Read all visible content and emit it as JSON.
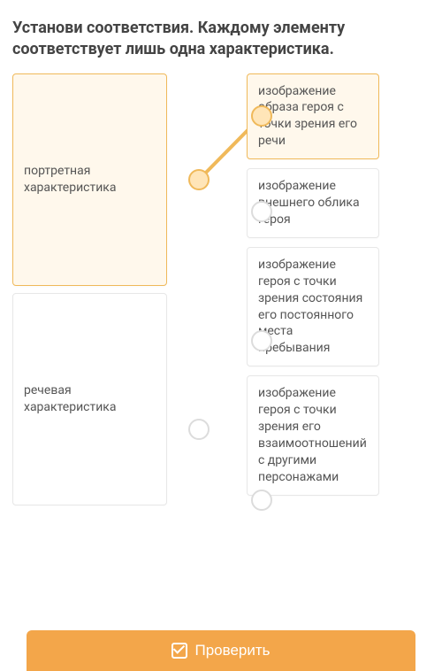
{
  "prompt": "Установи соответствия. Каждому элементу соответствует лишь одна характеристика.",
  "left_items": [
    {
      "label": "портретная характеристика",
      "selected": true
    },
    {
      "label": "речевая характеристика",
      "selected": false
    }
  ],
  "right_items": [
    {
      "label": "изображение образа героя с точки зрения его речи",
      "selected": true
    },
    {
      "label": "изображение внешнего облика героя",
      "selected": false
    },
    {
      "label": "изображение героя с точки зрения состояния его постоянного места пребывания",
      "selected": false
    },
    {
      "label": "изображение героя с точки зрения его взаимоотношений с другими персонажами",
      "selected": false
    }
  ],
  "connection": {
    "from_left": 0,
    "to_right": 0
  },
  "check_button_label": "Проверить",
  "colors": {
    "accent": "#f3a64a",
    "highlight_bg": "#fff8ec",
    "highlight_border": "#f0b95a"
  }
}
